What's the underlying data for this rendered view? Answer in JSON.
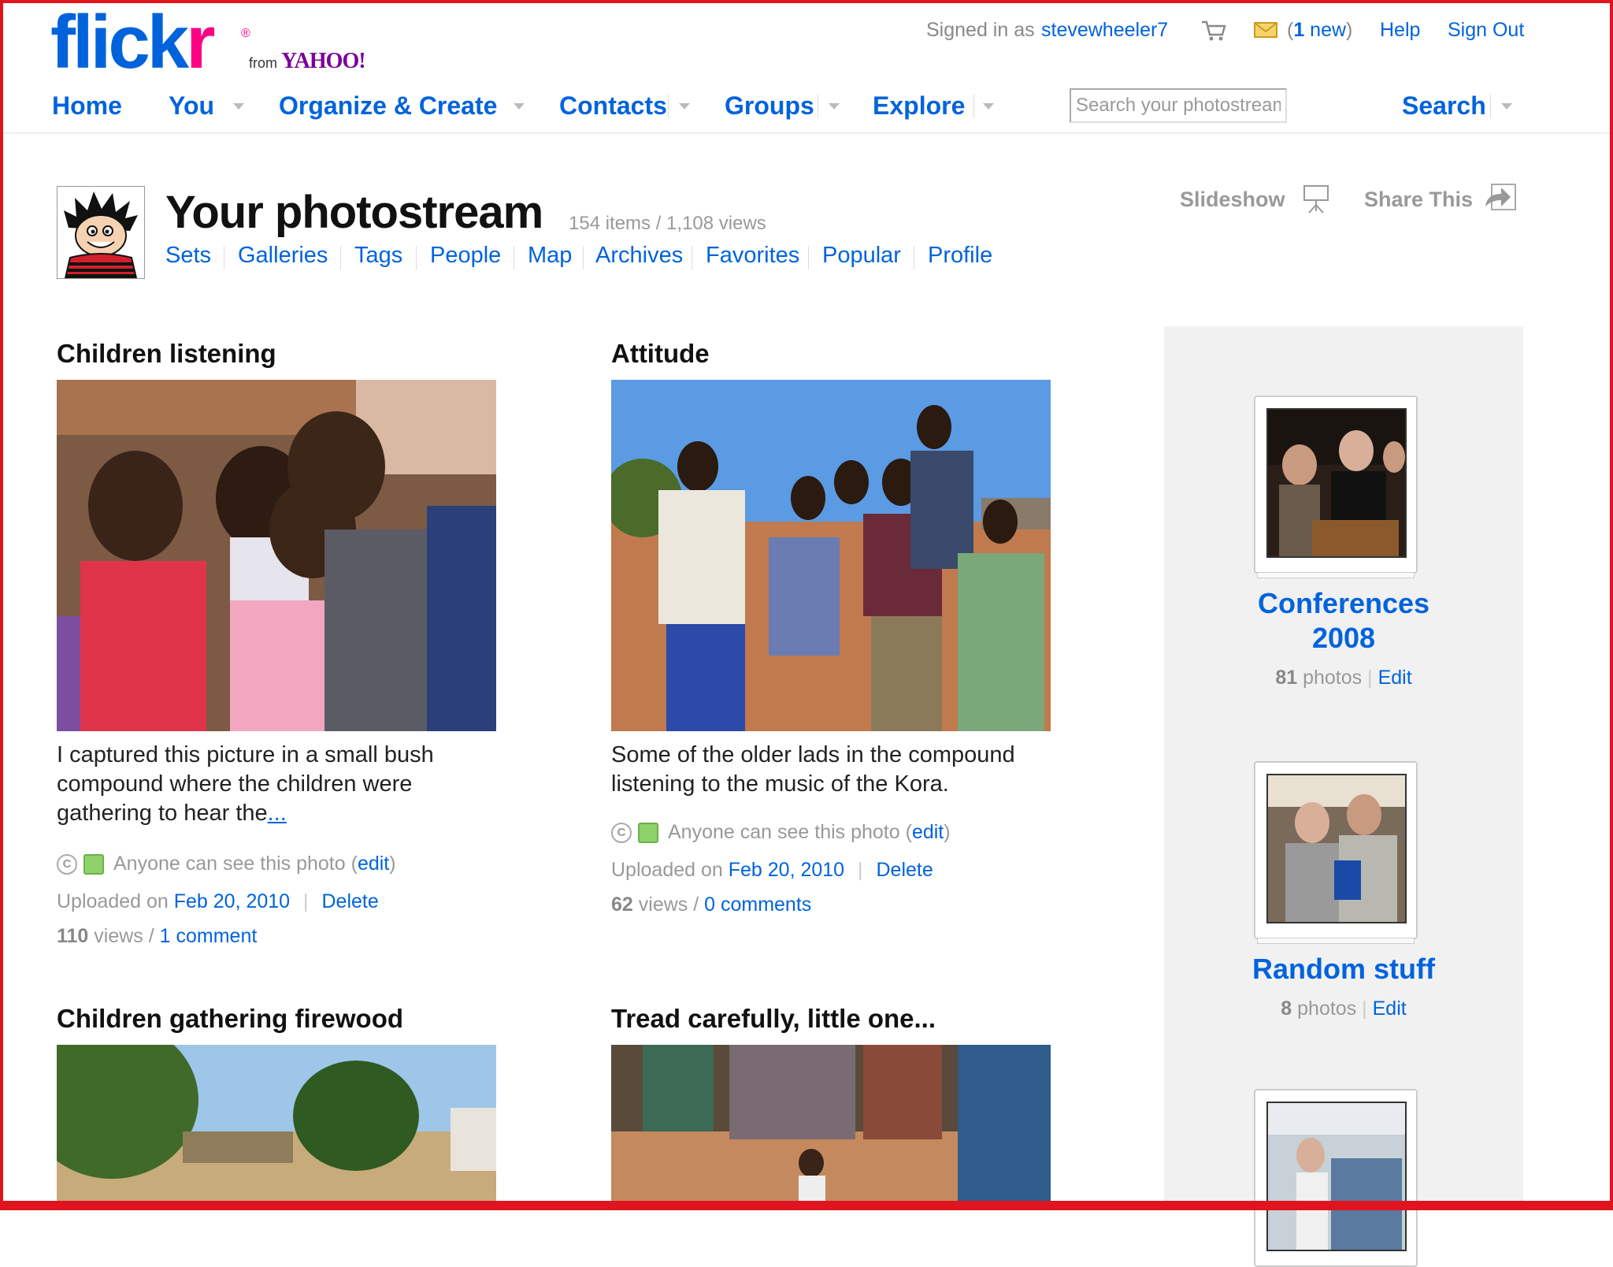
{
  "brand": {
    "logo_left": "flick",
    "logo_right": "r",
    "registered": "®",
    "from": "from",
    "yahoo": "YAHOO!"
  },
  "topbar": {
    "signed_in_as": "Signed in as",
    "username": "stevewheeler7",
    "mail_open": "(",
    "mail_count": "1",
    "mail_new": " new",
    "mail_close": ")",
    "help": "Help",
    "sign_out": "Sign Out"
  },
  "nav": {
    "home": "Home",
    "you": "You",
    "organize": "Organize & Create",
    "contacts": "Contacts",
    "groups": "Groups",
    "explore": "Explore"
  },
  "search": {
    "placeholder": "Search your photostream",
    "button": "Search"
  },
  "photostream": {
    "title": "Your photostream",
    "stats": "154 items / 1,108 views",
    "subnav": [
      "Sets",
      "Galleries",
      "Tags",
      "People",
      "Map",
      "Archives",
      "Favorites",
      "Popular",
      "Profile"
    ],
    "slideshow": "Slideshow",
    "share": "Share This"
  },
  "photos": [
    {
      "title": "Children listening",
      "desc": "I captured this picture in a small bush compound where the children were gathering to hear the",
      "more": "...",
      "privacy": "Anyone can see this photo (",
      "edit": "edit",
      "privacy_end": ")",
      "uploaded_label": "Uploaded on ",
      "date": "Feb 20, 2010",
      "delete": "Delete",
      "views_num": "110",
      "views_label": " views / ",
      "comments": "1 comment"
    },
    {
      "title": "Attitude",
      "desc": "Some of the older lads in the compound listening to the music of the Kora.",
      "privacy": "Anyone can see this photo (",
      "edit": "edit",
      "privacy_end": ")",
      "uploaded_label": "Uploaded on ",
      "date": "Feb 20, 2010",
      "delete": "Delete",
      "views_num": "62",
      "views_label": " views / ",
      "comments": "0 comments"
    },
    {
      "title": "Children gathering firewood"
    },
    {
      "title": "Tread carefully, little one..."
    }
  ],
  "sets": [
    {
      "title_line1": "Conferences",
      "title_line2": "2008",
      "count": "81",
      "photos_label": " photos",
      "edit": "Edit"
    },
    {
      "title_line1": "Random stuff",
      "count": "8",
      "photos_label": " photos",
      "edit": "Edit"
    }
  ],
  "colors": {
    "link": "#0063dc",
    "brand_pink": "#ff0084",
    "frame_red": "#e0141e",
    "sidebar_bg": "#f1f1f1"
  },
  "icons": [
    "cart-icon",
    "mail-icon",
    "caret-down-icon",
    "slideshow-icon",
    "share-icon",
    "copyright-icon",
    "privacy-icon"
  ]
}
